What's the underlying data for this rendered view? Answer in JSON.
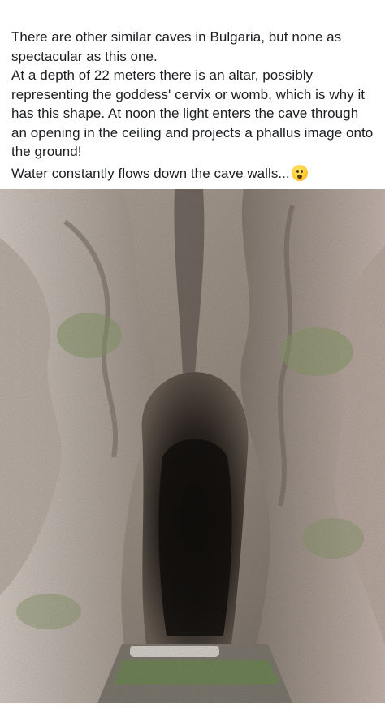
{
  "post": {
    "paragraphs": [
      "There are other similar caves in Bulgaria, but none as spectacular as this one.",
      "At a depth of 22 meters there is an altar, possibly representing the goddess' cervix or womb, which is why it has this shape. At noon the light enters the cave through an opening in the ceiling and projects a phallus image onto the ground!",
      "Water constantly flows down the cave walls..."
    ],
    "emoji_icon": "astonished-face-icon"
  },
  "photo": {
    "icon": "cave-photo",
    "colors": {
      "rock_light": "#c9bdb4",
      "rock_mid": "#8f8376",
      "rock_dark": "#4a413a",
      "moss": "#8a9a6a",
      "cave_dark": "#1b1714"
    }
  }
}
